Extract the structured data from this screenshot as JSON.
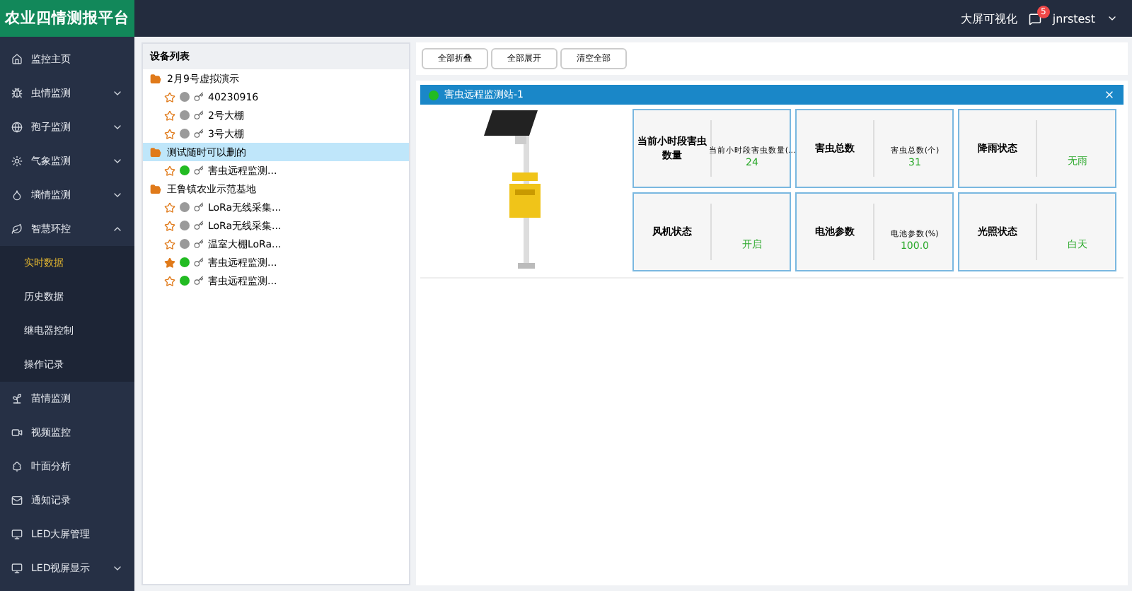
{
  "header": {
    "title": "农业四情测报平台",
    "link": "大屏可视化",
    "badge": "5",
    "user": "jnrstest"
  },
  "sidebar": {
    "items": [
      {
        "label": "监控主页"
      },
      {
        "label": "虫情监测",
        "expanded": false
      },
      {
        "label": "孢子监测",
        "expanded": false
      },
      {
        "label": "气象监测",
        "expanded": false
      },
      {
        "label": "墒情监测",
        "expanded": false
      },
      {
        "label": "智慧环控",
        "expanded": true,
        "children": [
          {
            "label": "实时数据",
            "selected": true
          },
          {
            "label": "历史数据",
            "selected": false
          },
          {
            "label": "继电器控制",
            "selected": false
          },
          {
            "label": "操作记录",
            "selected": false
          }
        ]
      },
      {
        "label": "苗情监测"
      },
      {
        "label": "视频监控"
      },
      {
        "label": "叶面分析"
      },
      {
        "label": "通知记录"
      },
      {
        "label": "LED大屏管理"
      },
      {
        "label": "LED视屏显示",
        "expanded": false
      }
    ]
  },
  "device_tree": {
    "title": "设备列表",
    "groups": [
      {
        "label": "2月9号虚拟演示",
        "selected": false,
        "children": [
          {
            "label": "40230916",
            "starred": false,
            "color": "#9a9a9a"
          },
          {
            "label": "2号大棚",
            "starred": false,
            "color": "#9a9a9a"
          },
          {
            "label": "3号大棚",
            "starred": false,
            "color": "#9a9a9a"
          }
        ]
      },
      {
        "label": "测试随时可以删的",
        "selected": true,
        "children": [
          {
            "label": "害虫远程监测...",
            "starred": false,
            "color": "#22bb22"
          }
        ]
      },
      {
        "label": "王鲁镇农业示范基地",
        "selected": false,
        "children": [
          {
            "label": "LoRa无线采集...",
            "starred": false,
            "color": "#9a9a9a"
          },
          {
            "label": "LoRa无线采集...",
            "starred": false,
            "color": "#9a9a9a"
          },
          {
            "label": "温室大棚LoRa...",
            "starred": false,
            "color": "#9a9a9a"
          },
          {
            "label": "害虫远程监测...",
            "starred": true,
            "color": "#22bb22"
          },
          {
            "label": "害虫远程监测...",
            "starred": false,
            "color": "#22bb22"
          }
        ]
      }
    ]
  },
  "toolbar": [
    "全部折叠",
    "全部展开",
    "清空全部"
  ],
  "panel": {
    "title": "害虫远程监测站-1",
    "online": true,
    "cards": [
      {
        "title": "当前小时段害虫数量",
        "label": "当前小时段害虫数量(...",
        "value": "24"
      },
      {
        "title": "害虫总数",
        "label": "害虫总数(个)",
        "value": "31"
      },
      {
        "title": "降雨状态",
        "value": "无雨"
      },
      {
        "title": "风机状态",
        "value": "开启"
      },
      {
        "title": "电池参数",
        "label": "电池参数(%)",
        "value": "100.0"
      },
      {
        "title": "光照状态",
        "value": "白天"
      }
    ]
  }
}
